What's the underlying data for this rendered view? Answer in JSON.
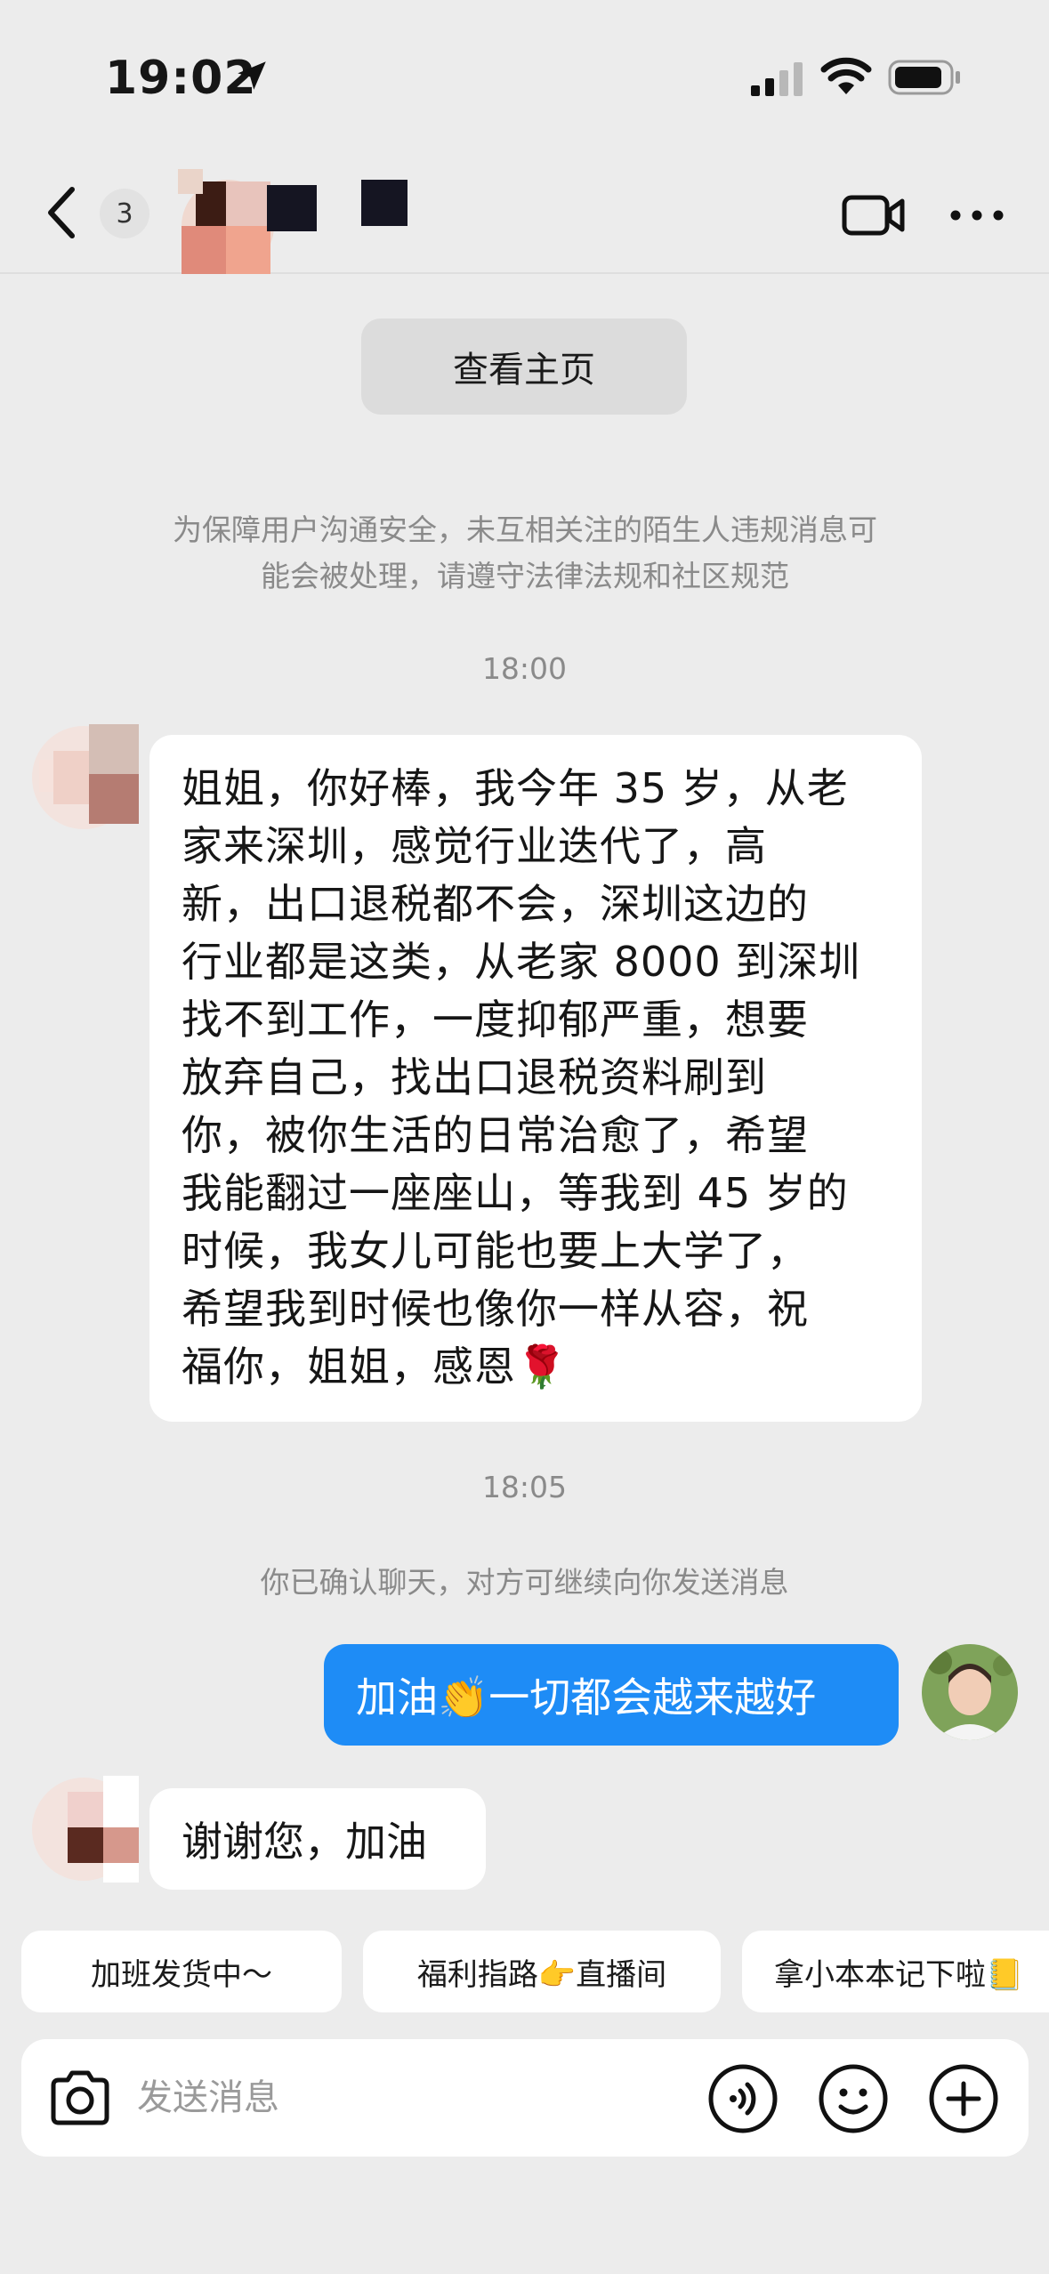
{
  "status_bar": {
    "time": "19:02",
    "icons": [
      "location-arrow-icon",
      "cellular-signal-icon",
      "wifi-icon",
      "battery-icon"
    ]
  },
  "header": {
    "unread_count": "3",
    "icons": [
      "chevron-left-icon",
      "video-call-icon",
      "more-dots-icon"
    ]
  },
  "chat": {
    "homepage_button": "查看主页",
    "safety_notice_line1": "为保障用户沟通安全，未互相关注的陌生人违规消息可",
    "safety_notice_line2": "能会被处理，请遵守法律法规和社区规范",
    "timestamp_1": "18:00",
    "message_1_lines": [
      "姐姐，你好棒，我今年 35 岁，从老",
      "家来深圳，感觉行业迭代了，高",
      "新，出口退税都不会，深圳这边的",
      "行业都是这类，从老家 8000 到深圳",
      "找不到工作，一度抑郁严重，想要",
      "放弃自己，找出口退税资料刷到",
      "你，被你生活的日常治愈了，希望",
      "我能翻过一座座山，等我到 45 岁的",
      "时候，我女儿可能也要上大学了，",
      "希望我到时候也像你一样从容，祝",
      "福你，姐姐，感恩🌹"
    ],
    "timestamp_2": "18:05",
    "system_message": "你已确认聊天，对方可继续向你发送消息",
    "reply_message": "加油👏一切都会越来越好",
    "message_2": "谢谢您，加油"
  },
  "quick_replies": [
    "加班发货中～",
    "福利指路👉直播间",
    "拿小本本记下啦📒"
  ],
  "input": {
    "placeholder": "发送消息",
    "icons": [
      "camera-icon",
      "voice-icon",
      "emoji-icon",
      "plus-icon"
    ]
  },
  "colors": {
    "background": "#ececec",
    "outgoing_bubble": "#1e8cf6",
    "incoming_bubble": "#ffffff",
    "meta_text": "#8a8a8a"
  }
}
